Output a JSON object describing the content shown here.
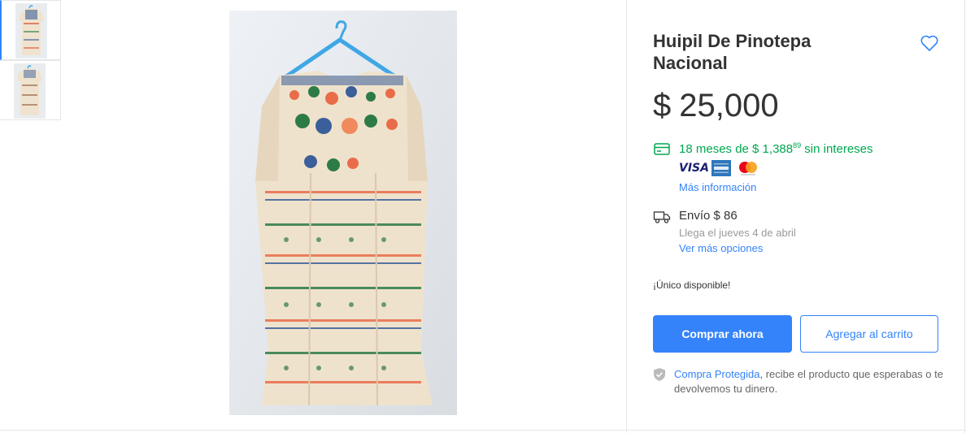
{
  "gallery": {
    "thumbnails": [
      "thumbnail-1",
      "thumbnail-2"
    ],
    "selected_index": 0
  },
  "product": {
    "title": "Huipil De Pinotepa Nacional",
    "currency_symbol": "$",
    "price": "25,000"
  },
  "payment": {
    "installments_prefix": "18 meses de $ 1,388",
    "installments_cents": "89",
    "installments_suffix": " sin intereses",
    "card_visa": "VISA",
    "more_info_link": "Más información",
    "icon": "credit-card-icon",
    "accent_color": "#00a650"
  },
  "shipping": {
    "label": "Envío $ 86",
    "arrival": "Llega el jueves 4 de abril",
    "more_options_link": "Ver más opciones",
    "icon": "truck-icon"
  },
  "stock": {
    "text": "¡Único disponible!"
  },
  "actions": {
    "buy_now": "Comprar ahora",
    "add_to_cart": "Agregar al carrito",
    "primary_color": "#3483fa"
  },
  "protection": {
    "link": "Compra Protegida",
    "text": ", recibe el producto que esperabas o te devolvemos tu dinero.",
    "icon": "shield-check-icon"
  }
}
